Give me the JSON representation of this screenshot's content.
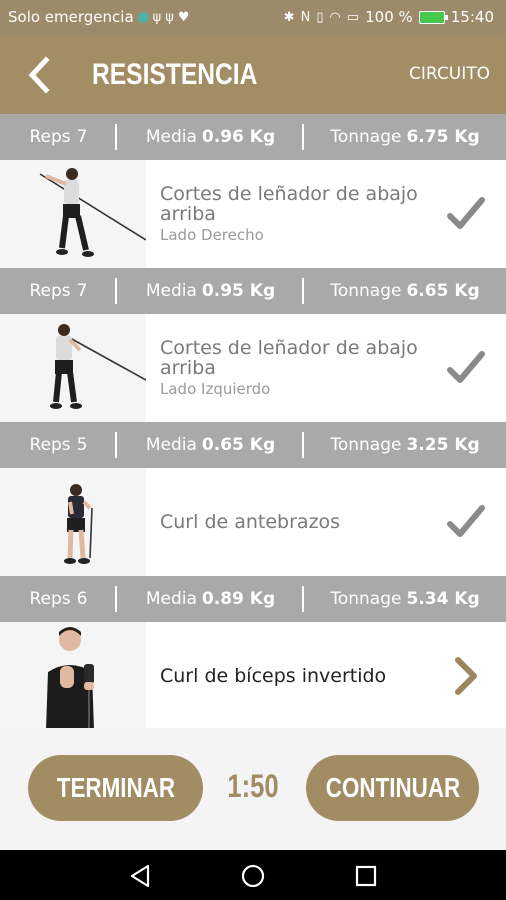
{
  "status_bar": {
    "carrier": "Solo emergencia",
    "battery": "100 %",
    "time": "15:40",
    "icons_left": [
      "circle-dot-icon",
      "usb-icon",
      "usb-icon",
      "heart-icon"
    ],
    "icons_right": [
      "bluetooth-icon",
      "nfc-icon",
      "vibrate-icon",
      "wifi-icon",
      "sim-icon",
      "battery-icon"
    ]
  },
  "appbar": {
    "title": "RESISTENCIA",
    "action": "CIRCUITO",
    "back_icon": "chevron-left-icon"
  },
  "exercises": [
    {
      "stats": {
        "reps_label": "Reps",
        "reps": "7",
        "media_label": "Media",
        "media": "0.96 Kg",
        "tonnage_label": "Tonnage",
        "tonnage": "6.75 Kg"
      },
      "name": "Cortes de leñador de abajo arriba",
      "side": "Lado Derecho",
      "status_icon": "check-icon"
    },
    {
      "stats": {
        "reps_label": "Reps",
        "reps": "7",
        "media_label": "Media",
        "media": "0.95 Kg",
        "tonnage_label": "Tonnage",
        "tonnage": "6.65 Kg"
      },
      "name": "Cortes de leñador de abajo arriba",
      "side": "Lado Izquierdo",
      "status_icon": "check-icon"
    },
    {
      "stats": {
        "reps_label": "Reps",
        "reps": "5",
        "media_label": "Media",
        "media": "0.65 Kg",
        "tonnage_label": "Tonnage",
        "tonnage": "3.25 Kg"
      },
      "name": "Curl de antebrazos",
      "side": "",
      "status_icon": "check-icon"
    },
    {
      "stats": {
        "reps_label": "Reps",
        "reps": "6",
        "media_label": "Media",
        "media": "0.89 Kg",
        "tonnage_label": "Tonnage",
        "tonnage": "5.34 Kg"
      },
      "name": "Curl de bíceps invertido",
      "side": "",
      "status_icon": "chevron-right-icon"
    }
  ],
  "footer": {
    "end_label": "TERMINAR",
    "timer": "1:50",
    "continue_label": "CONTINUAR"
  },
  "nav_bar": {
    "icons": [
      "nav-back-icon",
      "nav-home-icon",
      "nav-recents-icon"
    ]
  },
  "colors": {
    "brand": "#a38d65",
    "stats_bar": "#a9a9a9",
    "check": "#8a8a8a"
  }
}
